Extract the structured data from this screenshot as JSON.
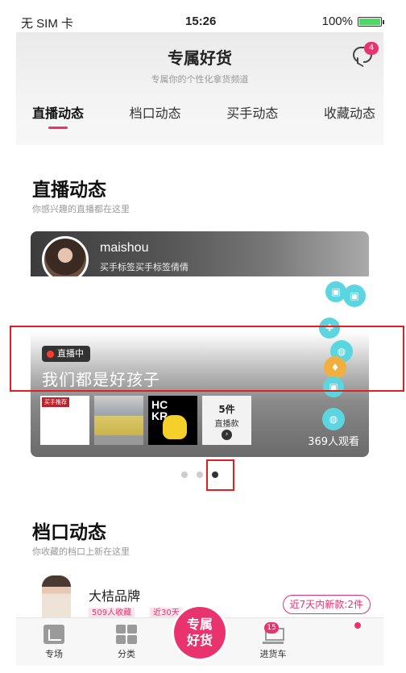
{
  "status_bar": {
    "carrier": "无 SIM 卡",
    "time": "15:26",
    "battery": "100%"
  },
  "header": {
    "title": "专属好货",
    "subtitle": "专属你的个性化拿货频道",
    "message_badge": "4"
  },
  "tabs": [
    {
      "label": "直播动态",
      "active": true
    },
    {
      "label": "档口动态",
      "active": false
    },
    {
      "label": "买手动态",
      "active": false
    },
    {
      "label": "收藏动态",
      "active": false
    }
  ],
  "live_section": {
    "title": "直播动态",
    "subtitle": "你感兴趣的直播都在这里",
    "card": {
      "host_name": "maishou",
      "host_tag": "买手标签买手标签倩倩",
      "badge": "直播中",
      "live_title": "我们都是好孩子",
      "thumb1_label": "买手推荐",
      "thumb3_text": "HC\nKR",
      "items_count": "5件",
      "items_label": "直播款",
      "viewers": "369人观看"
    },
    "pagination": {
      "total": 3,
      "active_index": 2
    }
  },
  "store_section": {
    "title": "档口动态",
    "subtitle": "你收藏的档口上新在这里",
    "store": {
      "name": "大桔品牌",
      "tag1": "509人收藏",
      "tag2": "近30天",
      "new_items": "近7天内新款:2件"
    }
  },
  "tabbar": {
    "market": "专场",
    "category": "分类",
    "center": "专属好货",
    "cart": "进货车",
    "cart_badge": "15"
  },
  "colors": {
    "accent": "#e8336f",
    "live_red": "#ff3b30",
    "float_cyan": "#5bd6e0",
    "highlight": "#e02020"
  }
}
